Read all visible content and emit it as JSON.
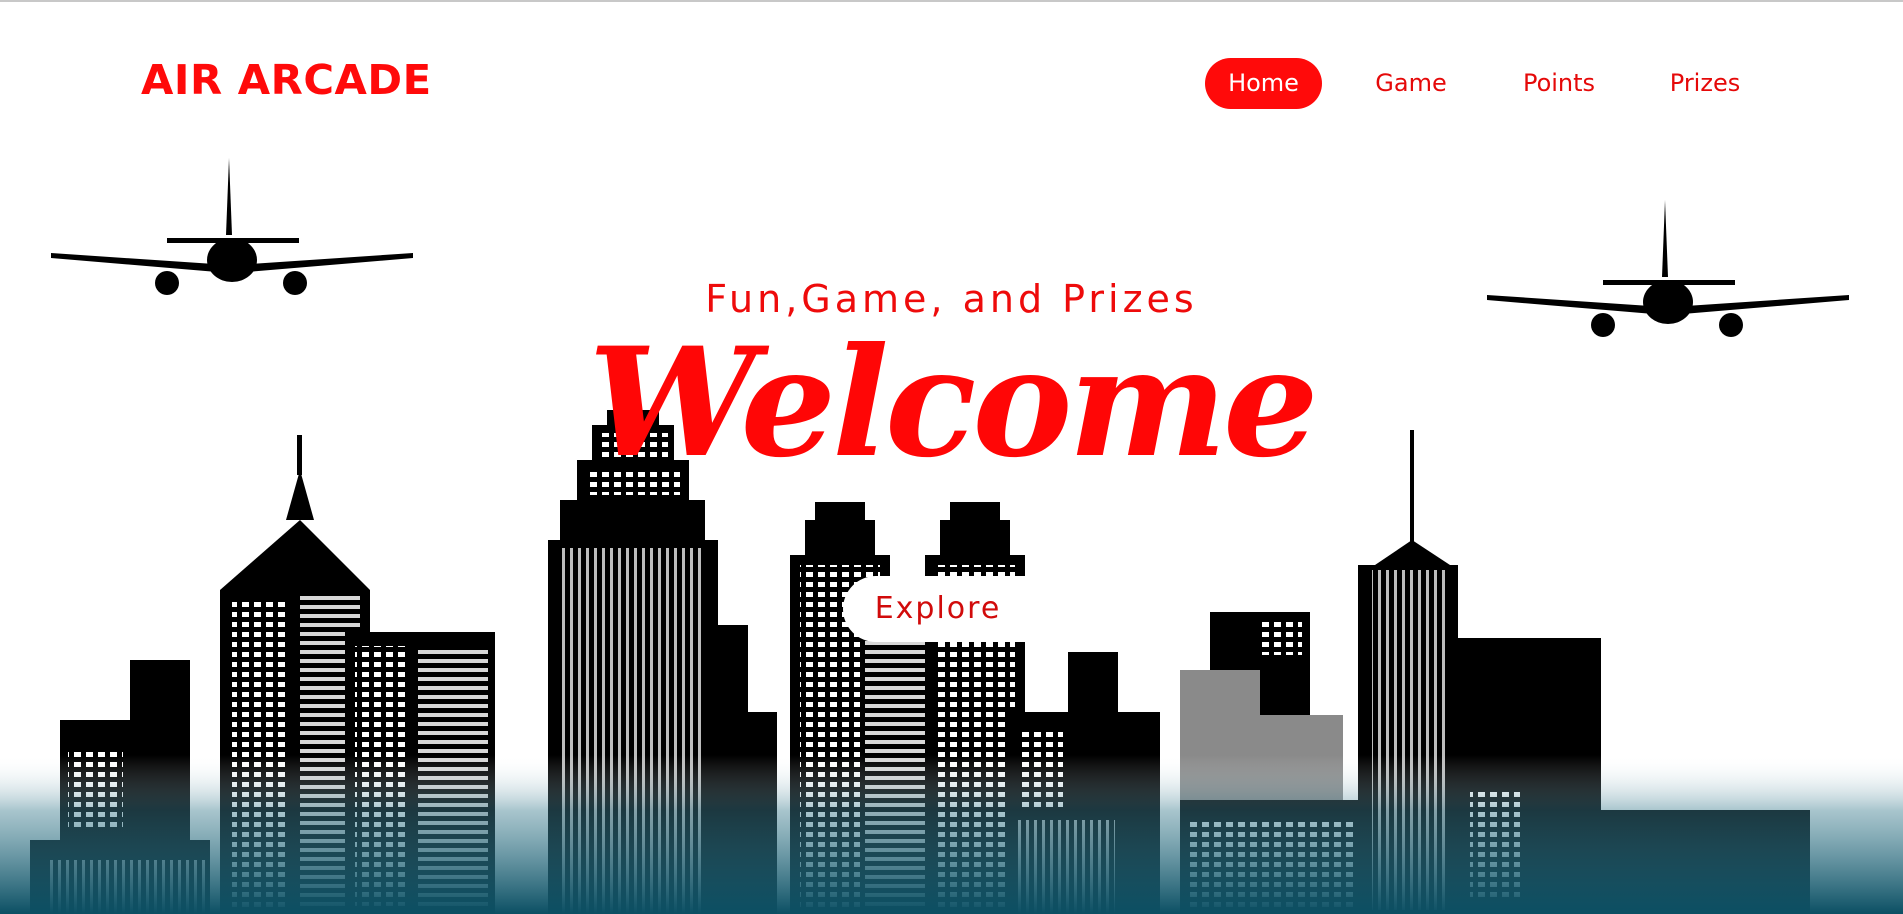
{
  "brand": {
    "name": "AIR ARCADE"
  },
  "nav": {
    "items": [
      {
        "label": "Home",
        "active": true
      },
      {
        "label": "Game",
        "active": false
      },
      {
        "label": "Points",
        "active": false
      },
      {
        "label": "Prizes",
        "active": false
      }
    ]
  },
  "hero": {
    "tagline": "Fun,Game, and Prizes",
    "title": "Welcome",
    "cta_label": "Explore"
  },
  "colors": {
    "brand_red": "#ff0a0a",
    "nav_active_text": "#ffffff",
    "skyline": "#000000",
    "ground_teal": "#0b4f63"
  },
  "icons": [
    "airplane-icon",
    "city-skyline-illustration"
  ]
}
